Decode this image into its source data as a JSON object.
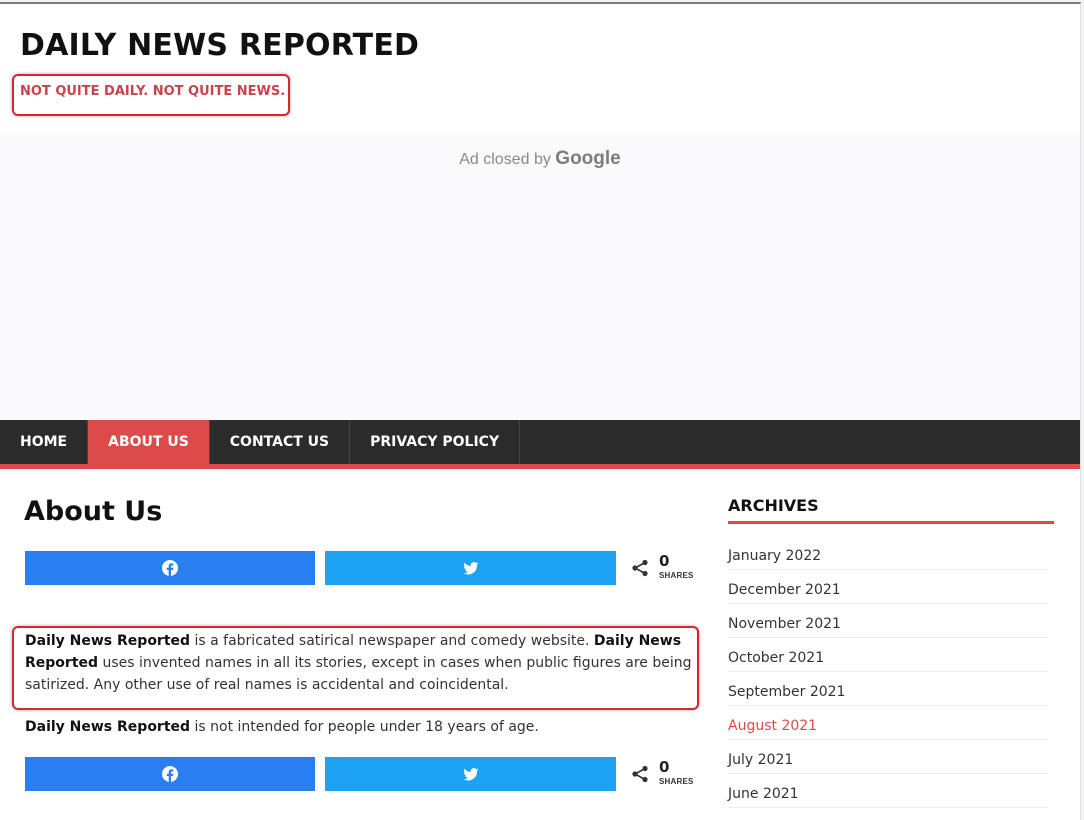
{
  "site": {
    "title": "DAILY NEWS REPORTED",
    "tagline": "NOT QUITE DAILY. NOT QUITE NEWS."
  },
  "ad": {
    "text": "Ad closed by",
    "brand": "Google"
  },
  "nav": {
    "items": [
      {
        "label": "HOME",
        "active": false
      },
      {
        "label": "ABOUT US",
        "active": true
      },
      {
        "label": "CONTACT US",
        "active": false
      },
      {
        "label": "PRIVACY POLICY",
        "active": false
      }
    ]
  },
  "page": {
    "heading": "About Us",
    "share": {
      "count": "0",
      "label": "SHARES",
      "facebook_icon": "facebook-icon",
      "twitter_icon": "twitter-icon"
    },
    "paragraph1": {
      "brand1": "Daily News Reported",
      "text1": " is a fabricated satirical newspaper and comedy website. ",
      "brand2": "Daily News Reported",
      "text2": " uses invented names in all its stories, except in cases when public figures are being satirized. Any other use of real names is accidental and coincidental."
    },
    "paragraph2": {
      "brand": "Daily News Reported",
      "text": " is not intended for people under 18 years of age."
    }
  },
  "sidebar": {
    "title": "ARCHIVES",
    "archives": [
      {
        "label": "January 2022",
        "active": false
      },
      {
        "label": "December 2021",
        "active": false
      },
      {
        "label": "November 2021",
        "active": false
      },
      {
        "label": "October 2021",
        "active": false
      },
      {
        "label": "September 2021",
        "active": false
      },
      {
        "label": "August 2021",
        "active": true
      },
      {
        "label": "July 2021",
        "active": false
      },
      {
        "label": "June 2021",
        "active": false
      }
    ]
  },
  "colors": {
    "accent": "#dd4a4a",
    "nav_bg": "#2b2b2b",
    "facebook": "#2a7ff0",
    "twitter": "#1da1f2",
    "highlight_box": "#d7262e"
  }
}
